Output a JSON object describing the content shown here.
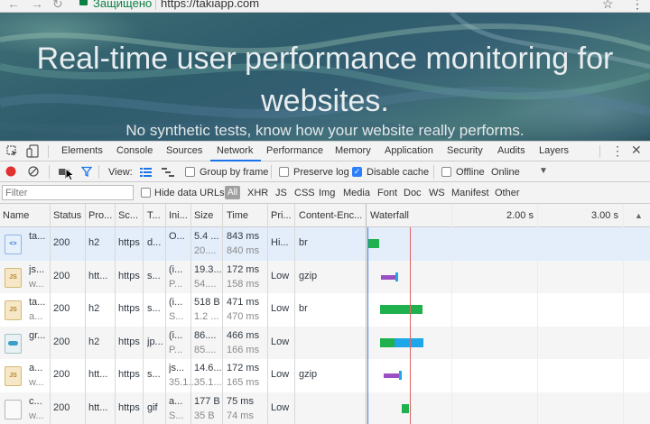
{
  "browser": {
    "secure_label": "Защищено",
    "url": "https://takiapp.com"
  },
  "hero": {
    "headline_line1": "Real-time user performance monitoring for",
    "headline_line2": "websites.",
    "subtitle": "No synthetic tests, know how your website really performs."
  },
  "devtools": {
    "tabs": [
      "Elements",
      "Console",
      "Sources",
      "Network",
      "Performance",
      "Memory",
      "Application",
      "Security",
      "Audits",
      "Layers"
    ],
    "active_tab": "Network",
    "toolbar": {
      "view_label": "View:",
      "group_by_frame": "Group by frame",
      "group_by_frame_checked": false,
      "preserve_log": "Preserve log",
      "preserve_log_checked": false,
      "disable_cache": "Disable cache",
      "disable_cache_checked": true,
      "offline": "Offline",
      "offline_checked": false,
      "throttle": "Online"
    },
    "filter": {
      "placeholder": "Filter",
      "hide_data_urls": "Hide data URLs",
      "types": [
        "All",
        "XHR",
        "JS",
        "CSS",
        "Img",
        "Media",
        "Font",
        "Doc",
        "WS",
        "Manifest",
        "Other"
      ],
      "active_type": "All"
    },
    "columns": {
      "name": "Name",
      "status": "Status",
      "protocol": "Pro...",
      "scheme": "Sc...",
      "type": "T...",
      "initiator": "Ini...",
      "size": "Size",
      "time": "Time",
      "priority": "Pri...",
      "content_encoding": "Content-Enc...",
      "waterfall": "Waterfall",
      "tick_2s": "2.00 s",
      "tick_3s": "3.00 s",
      "sort_indicator": "▲"
    },
    "rows": [
      {
        "icon": "doc",
        "name1": "ta...",
        "name2": "",
        "status": "200",
        "protocol": "h2",
        "scheme": "https",
        "type": "d...",
        "initiator1": "O...",
        "initiator2": "",
        "size1": "5.4 ...",
        "size2": "20....",
        "time1": "843 ms",
        "time2": "840 ms",
        "priority": "Hi...",
        "encoding": "br",
        "wf_start": 0.0,
        "wf_wait": 0.0,
        "wf_recv": 0.84,
        "wf_color": "#1fb14d"
      },
      {
        "icon": "js",
        "name1": "js...",
        "name2": "w...",
        "status": "200",
        "protocol": "htt...",
        "scheme": "https",
        "type": "s...",
        "initiator1": "(i...",
        "initiator2": "P...",
        "size1": "19.3...",
        "size2": "54....",
        "time1": "172 ms",
        "time2": "158 ms",
        "priority": "Low",
        "encoding": "gzip",
        "wf_start": 0.96,
        "wf_wait": 1.1,
        "wf_recv": 0.16,
        "wf_color": "#1da7e8"
      },
      {
        "icon": "js",
        "name1": "ta...",
        "name2": "a...",
        "status": "200",
        "protocol": "h2",
        "scheme": "https",
        "type": "s...",
        "initiator1": "(i...",
        "initiator2": "S...",
        "size1": "518 B",
        "size2": "1.2 ...",
        "time1": "471 ms",
        "time2": "470 ms",
        "priority": "Low",
        "encoding": "br",
        "wf_start": 0.93,
        "wf_wait": 0.0,
        "wf_recv": 3.0,
        "wf_color": "#1fb14d"
      },
      {
        "icon": "img",
        "name1": "gr...",
        "name2": "",
        "status": "200",
        "protocol": "h2",
        "scheme": "https",
        "type": "jp...",
        "initiator1": "(i...",
        "initiator2": "P...",
        "size1": "86....",
        "size2": "85....",
        "time1": "466 ms",
        "time2": "166 ms",
        "priority": "Low",
        "encoding": "",
        "wf_start": 0.93,
        "wf_wait": 0.0,
        "wf_recv": 3.05,
        "wf_color": "#1da7e8"
      },
      {
        "icon": "js",
        "name1": "a...",
        "name2": "w...",
        "status": "200",
        "protocol": "htt...",
        "scheme": "https",
        "type": "s...",
        "initiator1": "js...",
        "initiator2": "35.1...",
        "size1": "14.6...",
        "size2": "35.1...",
        "time1": "172 ms",
        "time2": "165 ms",
        "priority": "Low",
        "encoding": "gzip",
        "wf_start": 1.19,
        "wf_wait": 1.1,
        "wf_recv": 0.16,
        "wf_color": "#1da7e8"
      },
      {
        "icon": "blank",
        "name1": "c...",
        "name2": "w...",
        "status": "200",
        "protocol": "htt...",
        "scheme": "https",
        "type": "gif",
        "initiator1": "a...",
        "initiator2": "S...",
        "size1": "177 B",
        "size2": "35 B",
        "time1": "75 ms",
        "time2": "74 ms",
        "priority": "Low",
        "encoding": "",
        "wf_start": 2.44,
        "wf_wait": 0.0,
        "wf_recv": 0.5,
        "wf_color": "#1fb14d"
      }
    ],
    "waterfall_colors": {
      "dom_content_loaded": "#4b7ff0",
      "load": "#e06262",
      "wait": "#9c4fc2"
    }
  }
}
